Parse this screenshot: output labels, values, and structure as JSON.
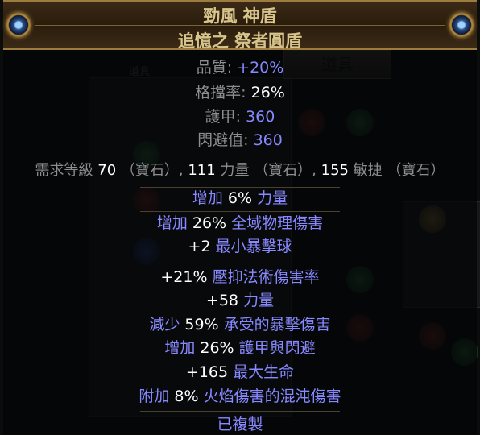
{
  "item": {
    "name": "勁風 神盾",
    "base_type": "追憶之 祭者圓盾",
    "properties": [
      {
        "label": "品質",
        "value": "+20%"
      },
      {
        "label": "格擋率",
        "value": "26%"
      },
      {
        "label": "護甲",
        "value": "360"
      },
      {
        "label": "閃避值",
        "value": "360"
      }
    ],
    "requirements": {
      "prefix": "需求等級",
      "level": "70",
      "gem1": "（寶石）,",
      "str": "111",
      "str_label": "力量",
      "gem2": "（寶石）,",
      "dex": "155",
      "dex_label": "敏捷",
      "gem3": "（寶石）"
    },
    "implicit": [
      {
        "pre": "增加 ",
        "num": "6%",
        "post": " 力量"
      }
    ],
    "explicit": [
      {
        "pre": "增加 ",
        "num": "26%",
        "post": " 全域物理傷害"
      },
      {
        "pre": "",
        "num": "+2",
        "post": " 最小暴擊球"
      },
      {
        "pre": "",
        "num": "+21%",
        "post": " 壓抑法術傷害率"
      },
      {
        "pre": "",
        "num": "+58",
        "post": " 力量"
      },
      {
        "pre": "減少 ",
        "num": "59%",
        "post": " 承受的暴擊傷害"
      },
      {
        "pre": "增加 ",
        "num": "26%",
        "post": " 護甲與閃避"
      },
      {
        "pre": "",
        "num": "+165",
        "post": " 最大生命"
      },
      {
        "pre": "附加 ",
        "num": "8%",
        "post": " 火焰傷害的混沌傷害"
      }
    ],
    "footer": "已複製"
  },
  "background": {
    "tab_label": "道具",
    "tab_label_small": "道具"
  },
  "colors": {
    "name": "#d8c58c",
    "magic_blue": "#8888ff",
    "label_gray": "#8e8e8e",
    "header_border": "#9e7c3e"
  }
}
